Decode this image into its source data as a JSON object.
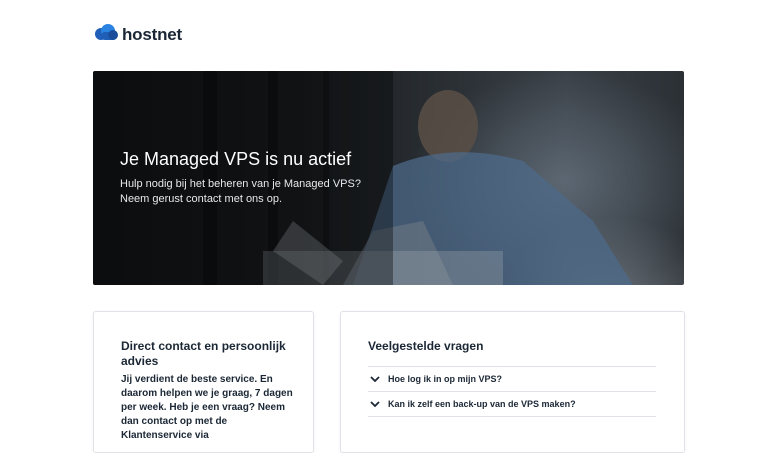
{
  "brand": {
    "name": "hostnet",
    "accent": "#1a6fd1"
  },
  "hero": {
    "title": "Je Managed VPS is nu actief",
    "subtitle_line1": "Hulp nodig bij het beheren van je Managed VPS?",
    "subtitle_line2": "Neem gerust contact met ons op."
  },
  "contact": {
    "title": "Direct contact en persoonlijk advies",
    "body": "Jij verdient de beste service. En daarom helpen we je graag, 7 dagen per week. Heb je een vraag? Neem dan contact op met de Klantenservice via"
  },
  "faq": {
    "title": "Veelgestelde vragen",
    "items": [
      {
        "label": "Hoe log ik in op mijn VPS?",
        "icon": "chevron-down-icon"
      },
      {
        "label": "Kan ik zelf een back-up van de VPS maken?",
        "icon": "chevron-down-icon"
      }
    ]
  }
}
